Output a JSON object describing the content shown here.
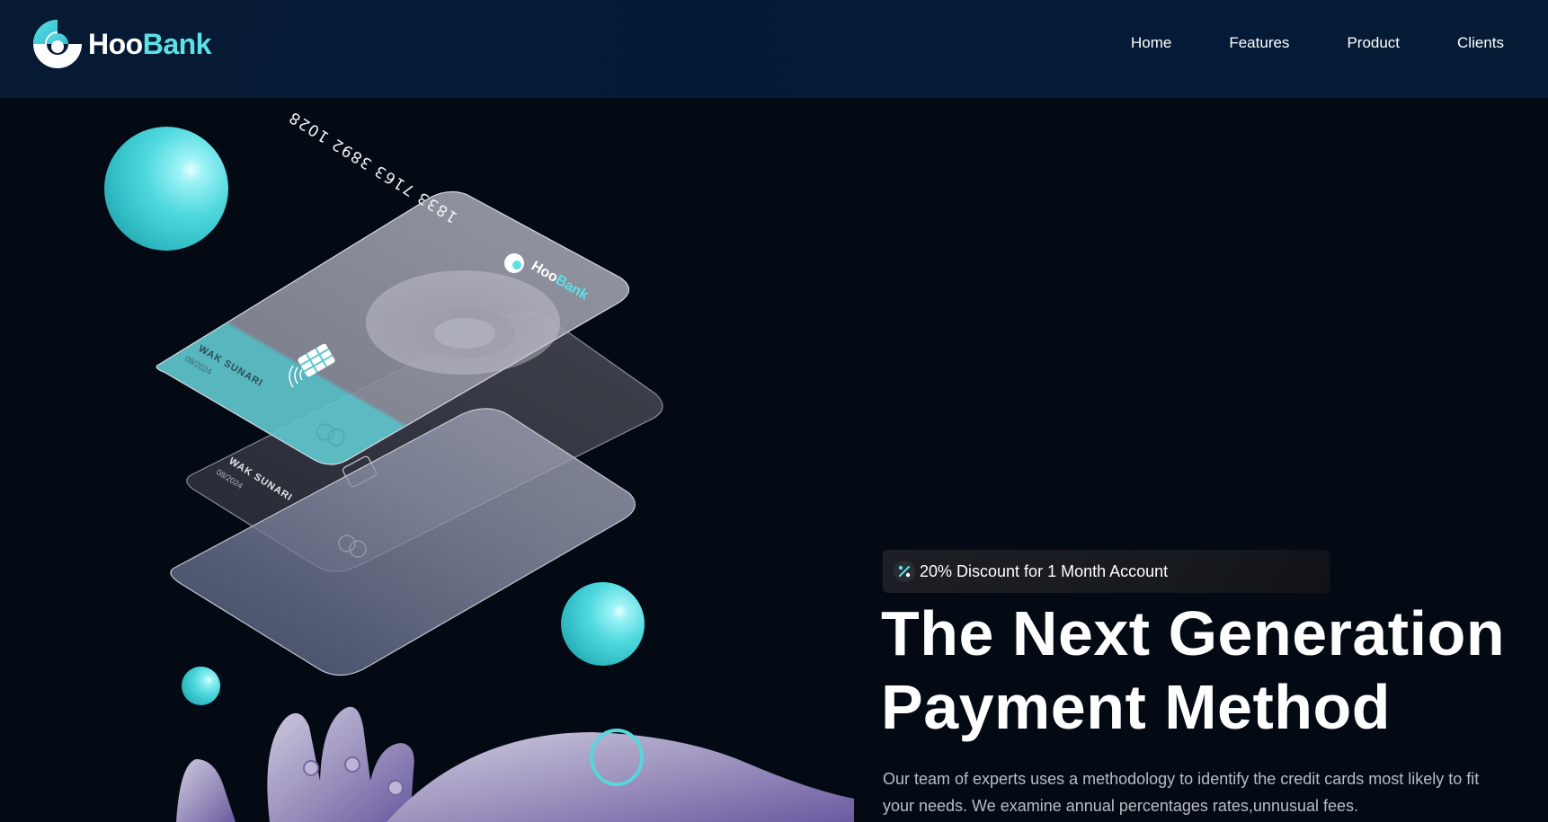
{
  "brand": {
    "name_part1": "Hoo",
    "name_part2": "Bank",
    "accent_color": "#5ce1e6"
  },
  "nav": {
    "items": [
      {
        "label": "Home"
      },
      {
        "label": "Features"
      },
      {
        "label": "Product"
      },
      {
        "label": "Clients"
      }
    ]
  },
  "hero": {
    "badge": {
      "icon": "discount-percent-icon",
      "text": "20% Discount for 1 Month Account"
    },
    "headline_line1": "The Next Generation",
    "headline_line2": "Payment Method",
    "description": "Our team of experts uses a methodology to identify the credit cards most likely to fit your needs. We examine annual percentages rates,unnusual fees."
  },
  "illustration": {
    "top_card": {
      "number": "1833 7163 3892 1028",
      "holder": "WAK SUNARI",
      "expiry": "08/2024",
      "brand_part1": "Hoo",
      "brand_part2": "Bank"
    },
    "middle_card": {
      "holder": "WAK SUNARI",
      "expiry": "08/2024"
    }
  },
  "colors": {
    "background": "#040a14",
    "navbar": "#061a33",
    "text_muted": "#b9bcc4",
    "sphere": "#4fd9df"
  }
}
